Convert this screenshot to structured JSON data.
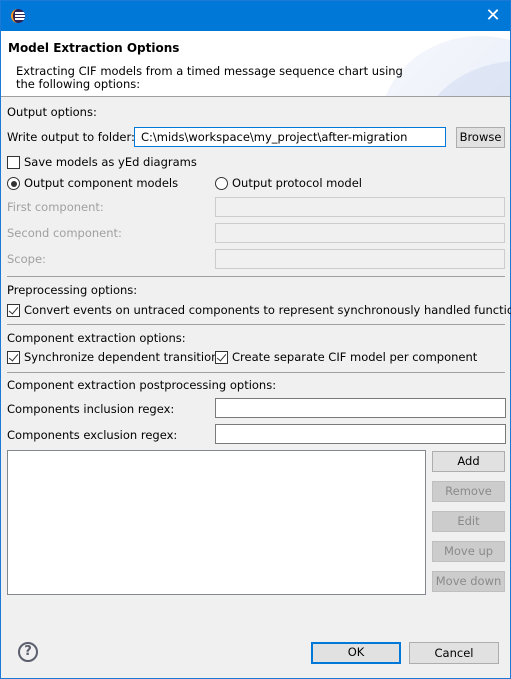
{
  "window": {
    "title": "",
    "close_glyph": "✕"
  },
  "header": {
    "title": "Model Extraction Options",
    "description": "Extracting CIF models from a timed message sequence chart using the following options:"
  },
  "output": {
    "section_label": "Output options:",
    "folder_label": "Write output to folder:",
    "folder_value": "C:\\mids\\workspace\\my_project\\after-migration",
    "browse_label": "Browse",
    "save_yed_label": "Save models as yEd diagrams",
    "save_yed_checked": false,
    "radio_component_label": "Output component models",
    "radio_protocol_label": "Output protocol model",
    "selected_output": "component",
    "first_component_label": "First component:",
    "first_component_value": "",
    "second_component_label": "Second component:",
    "second_component_value": "",
    "scope_label": "Scope:",
    "scope_value": ""
  },
  "preprocessing": {
    "section_label": "Preprocessing options:",
    "convert_label": "Convert events on untraced components to represent synchronously handled functions",
    "convert_checked": true
  },
  "component_extraction": {
    "section_label": "Component extraction options:",
    "sync_label": "Synchronize dependent transitions",
    "sync_checked": true,
    "separate_label": "Create separate CIF model per component",
    "separate_checked": true
  },
  "postprocessing": {
    "section_label": "Component extraction postprocessing options:",
    "inclusion_label": "Components inclusion regex:",
    "inclusion_value": "",
    "exclusion_label": "Components exclusion regex:",
    "exclusion_value": "",
    "list_items": [],
    "buttons": {
      "add": "Add",
      "remove": "Remove",
      "edit": "Edit",
      "move_up": "Move up",
      "move_down": "Move down"
    }
  },
  "footer": {
    "help_glyph": "?",
    "ok_label": "OK",
    "cancel_label": "Cancel"
  }
}
